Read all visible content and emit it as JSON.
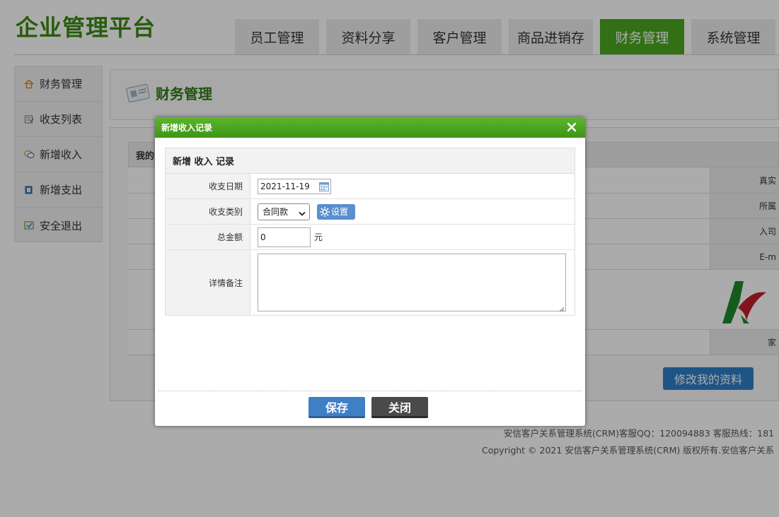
{
  "header": {
    "logo": "企业管理平台"
  },
  "nav": {
    "tabs": [
      {
        "label": "员工管理"
      },
      {
        "label": "资料分享"
      },
      {
        "label": "客户管理"
      },
      {
        "label": "商品进销存"
      },
      {
        "label": "财务管理",
        "active": true
      },
      {
        "label": "系统管理"
      }
    ]
  },
  "sidebar": {
    "items": [
      {
        "label": "财务管理",
        "icon": "home-icon"
      },
      {
        "label": "收支列表",
        "icon": "list-icon"
      },
      {
        "label": "新增收入",
        "icon": "chat-icon"
      },
      {
        "label": "新增支出",
        "icon": "book-icon"
      },
      {
        "label": "安全退出",
        "icon": "exit-icon"
      }
    ]
  },
  "main": {
    "title": "财务管理",
    "section_title": "我的",
    "row_labels": [
      "真实",
      "所属",
      "入司",
      "E-m",
      "家"
    ],
    "edit_profile_label": "修改我的资料"
  },
  "footer": {
    "line1": "安信客户关系管理系统(CRM)客服QQ：120094883 客服热线：181",
    "line2": "Copyright © 2021 安信客户关系管理系统(CRM) 版权所有.安信客户关系"
  },
  "dialog": {
    "title": "新增收入记录",
    "form_heading": "新增 收入 记录",
    "date_label": "收支日期",
    "date_value": "2021-11-19",
    "category_label": "收支类别",
    "category_value": "合同款",
    "settings_label": "设置",
    "amount_label": "总金额",
    "amount_value": "0",
    "amount_unit": "元",
    "notes_label": "详情备注",
    "notes_value": "",
    "save_label": "保存",
    "close_label": "关闭"
  },
  "colors": {
    "brand_green": "#3b8a12",
    "active_tab": "#4da820",
    "save_blue": "#3e7fc6"
  }
}
